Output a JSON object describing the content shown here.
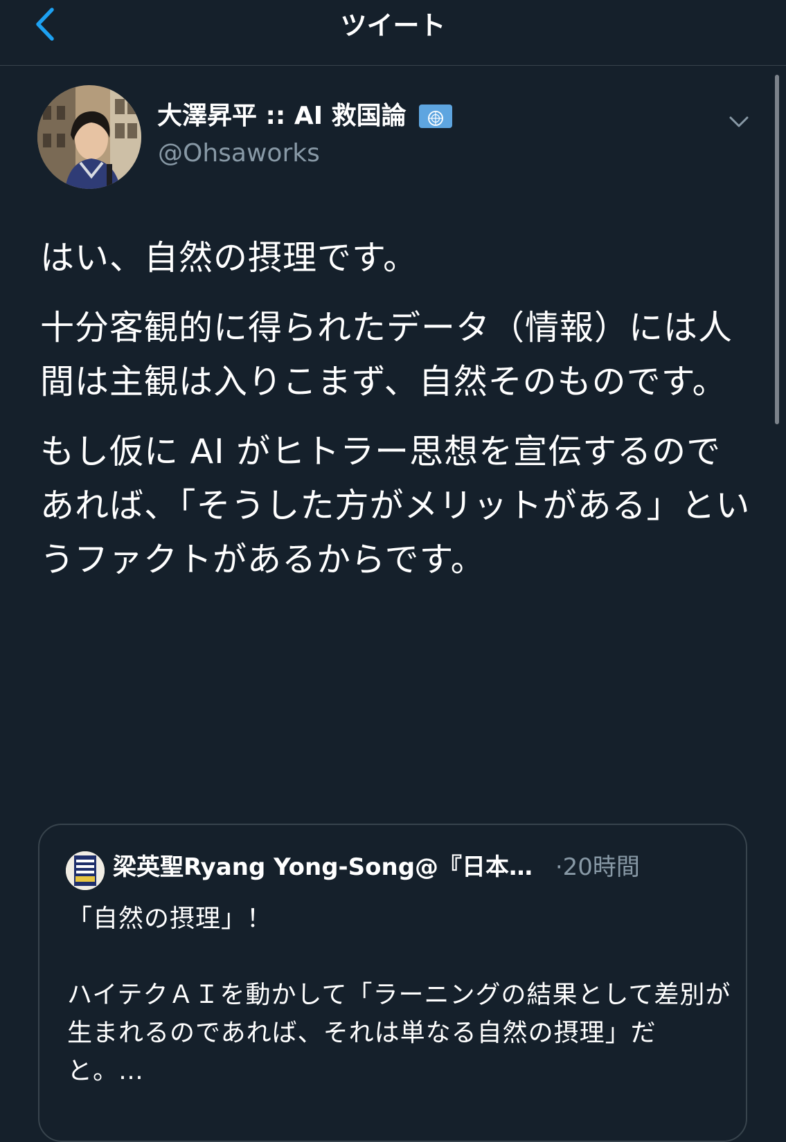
{
  "header": {
    "title": "ツイート",
    "back_icon": "chevron-left-icon"
  },
  "colors": {
    "background": "#15202b",
    "accent": "#1da1f2",
    "border": "#38444d",
    "secondary_text": "#8899a6",
    "primary_text": "#ffffff"
  },
  "tweet": {
    "author_name": "大澤昇平 :: AI 救国論",
    "author_flag_icon": "united-nations-flag-icon",
    "author_handle": "@Ohsaworks",
    "menu_icon": "chevron-down-icon",
    "paragraphs": [
      "はい、自然の摂理です。",
      "十分客観的に得られたデータ（情報）には人間は主観は入りこまず、自然そのものです。",
      "もし仮に AI がヒトラー思想を宣伝するのであれば、「そうした方がメリットがある」というファクトがあるからです。"
    ]
  },
  "quoted_tweet": {
    "author_name": "梁英聖Ryang Yong-Song@『日本…",
    "time": "·20時間",
    "line1": "「自然の摂理」！",
    "line2": "ハイテクＡＩを動かして「ラーニングの結果として差別が生まれるのであれば、それは単なる自然の摂理」だと。…"
  }
}
